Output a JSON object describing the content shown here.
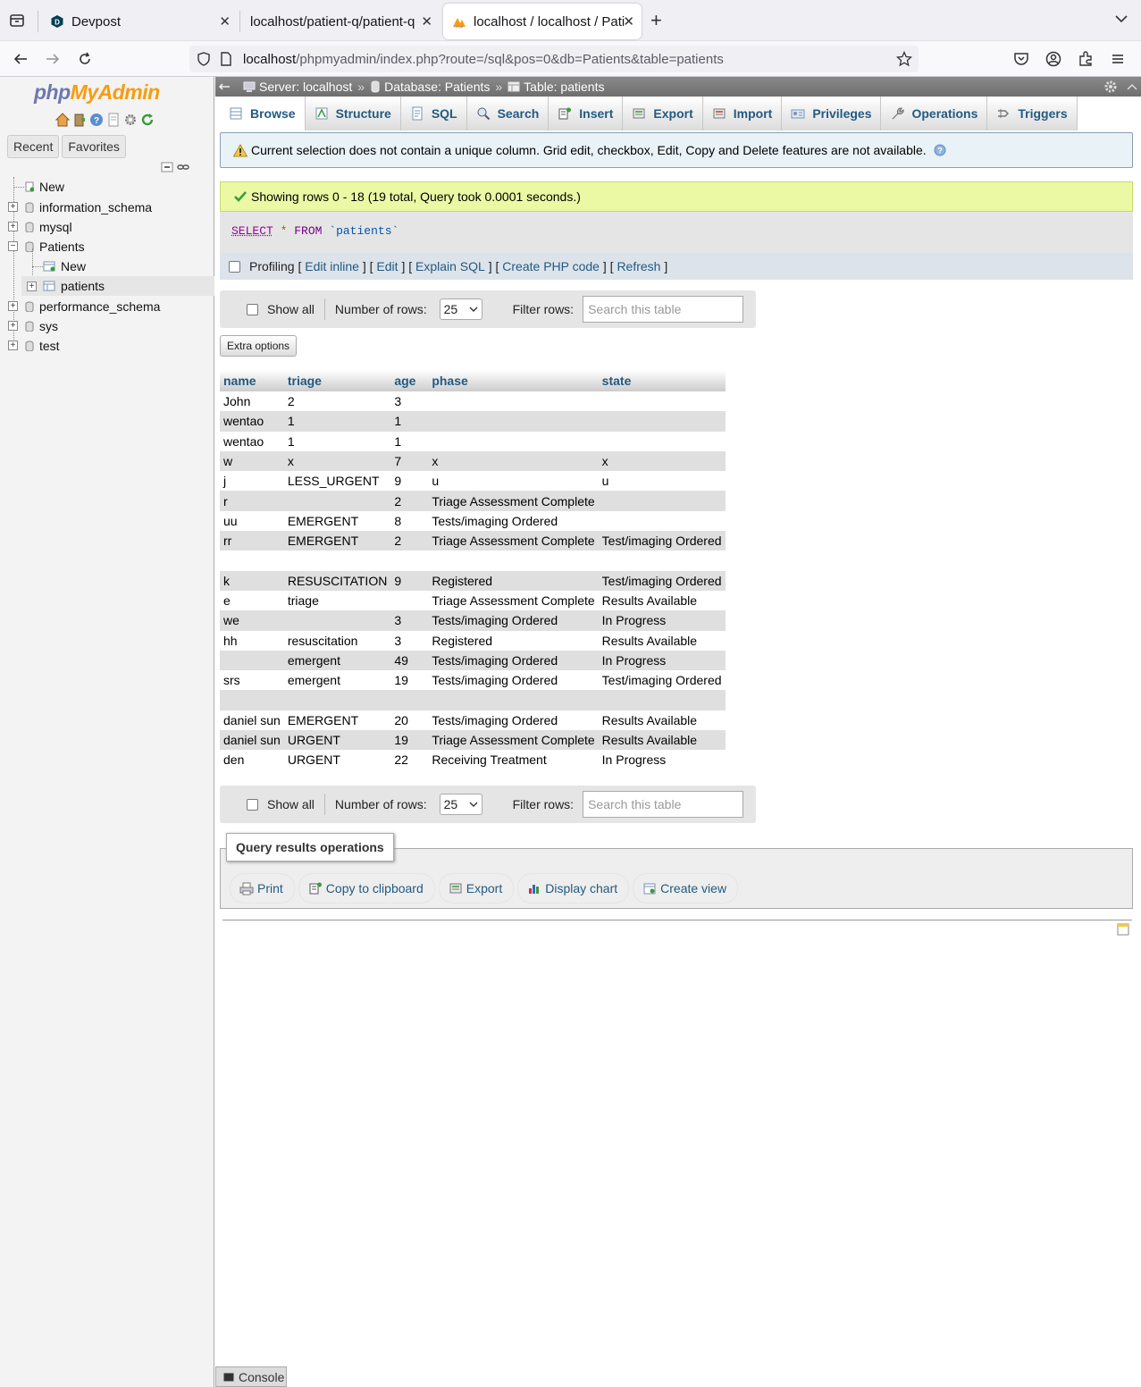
{
  "browser": {
    "tabs": [
      {
        "title": "Devpost",
        "active": false
      },
      {
        "title": "localhost/patient-q/patient-q",
        "active": false
      },
      {
        "title": "localhost / localhost / Pati",
        "active": true
      }
    ],
    "new_tab": "+",
    "url_host": "localhost",
    "url_path": "/phpmyadmin/index.php?route=/sql&pos=0&db=Patients&table=patients"
  },
  "sidebar": {
    "logo_php": "php",
    "logo_myadmin": "MyAdmin",
    "recent": "Recent",
    "favorites": "Favorites",
    "tree": {
      "new_root": "New",
      "db1": "information_schema",
      "db2": "mysql",
      "db3": "Patients",
      "db3_new": "New",
      "db3_table": "patients",
      "db4": "performance_schema",
      "db5": "sys",
      "db6": "test"
    }
  },
  "breadcrumb": {
    "server": "Server: localhost",
    "database": "Database: Patients",
    "table": "Table: patients",
    "sep": "»"
  },
  "tabs": {
    "browse": "Browse",
    "structure": "Structure",
    "sql": "SQL",
    "search": "Search",
    "insert": "Insert",
    "export": "Export",
    "import": "Import",
    "privileges": "Privileges",
    "operations": "Operations",
    "triggers": "Triggers"
  },
  "notice": "Current selection does not contain a unique column. Grid edit, checkbox, Edit, Copy and Delete features are not available.",
  "success": "Showing rows 0 - 18 (19 total, Query took 0.0001 seconds.)",
  "sql": {
    "select": "SELECT",
    "star": "*",
    "from": "FROM",
    "table": "`patients`"
  },
  "profiling": {
    "label": "Profiling",
    "edit_inline": "Edit inline",
    "edit": "Edit",
    "explain": "Explain SQL",
    "php": "Create PHP code",
    "refresh": "Refresh",
    "lb": "[",
    "rb": "]"
  },
  "nav": {
    "show_all": "Show all",
    "num_rows_label": "Number of rows:",
    "num_rows_value": "25",
    "filter_label": "Filter rows:",
    "filter_placeholder": "Search this table"
  },
  "extra_options": "Extra options",
  "table": {
    "headers": [
      "name",
      "triage",
      "age",
      "phase",
      "state"
    ],
    "rows": [
      [
        "John",
        "2",
        "3",
        "",
        ""
      ],
      [
        "wentao",
        "1",
        "1",
        "",
        ""
      ],
      [
        "wentao",
        "1",
        "1",
        "",
        ""
      ],
      [
        "w",
        "x",
        "7",
        "x",
        "x"
      ],
      [
        "j",
        "LESS_URGENT",
        "9",
        "u",
        "u"
      ],
      [
        "r",
        "",
        "2",
        "Triage Assessment Complete",
        ""
      ],
      [
        "uu",
        "EMERGENT",
        "8",
        "Tests/imaging Ordered",
        ""
      ],
      [
        "rr",
        "EMERGENT",
        "2",
        "Triage Assessment Complete",
        "Test/imaging Ordered"
      ],
      [
        "",
        "",
        "",
        "",
        ""
      ],
      [
        "k",
        "RESUSCITATION",
        "9",
        "Registered",
        "Test/imaging Ordered"
      ],
      [
        "e",
        "triage",
        "",
        "Triage Assessment Complete",
        "Results Available"
      ],
      [
        "we",
        "",
        "3",
        "Tests/imaging Ordered",
        "In Progress"
      ],
      [
        "hh",
        "resuscitation",
        "3",
        "Registered",
        "Results Available"
      ],
      [
        "",
        "emergent",
        "49",
        "Tests/imaging Ordered",
        "In Progress"
      ],
      [
        "srs",
        "emergent",
        "19",
        "Tests/imaging Ordered",
        "Test/imaging Ordered"
      ],
      [
        "",
        "",
        "",
        "",
        ""
      ],
      [
        "daniel sun",
        "EMERGENT",
        "20",
        "Tests/imaging Ordered",
        "Results Available"
      ],
      [
        "daniel sun",
        "URGENT",
        "19",
        "Triage Assessment Complete",
        "Results Available"
      ],
      [
        "den",
        "URGENT",
        "22",
        "Receiving Treatment",
        "In Progress"
      ]
    ]
  },
  "query_ops": {
    "legend": "Query results operations",
    "print": "Print",
    "copy": "Copy to clipboard",
    "export": "Export",
    "chart": "Display chart",
    "view": "Create view"
  },
  "console": "Console",
  "colors": {
    "link": "#235a81",
    "success_bg": "#ebf8a4",
    "notice_bg": "#e9f2f7"
  }
}
